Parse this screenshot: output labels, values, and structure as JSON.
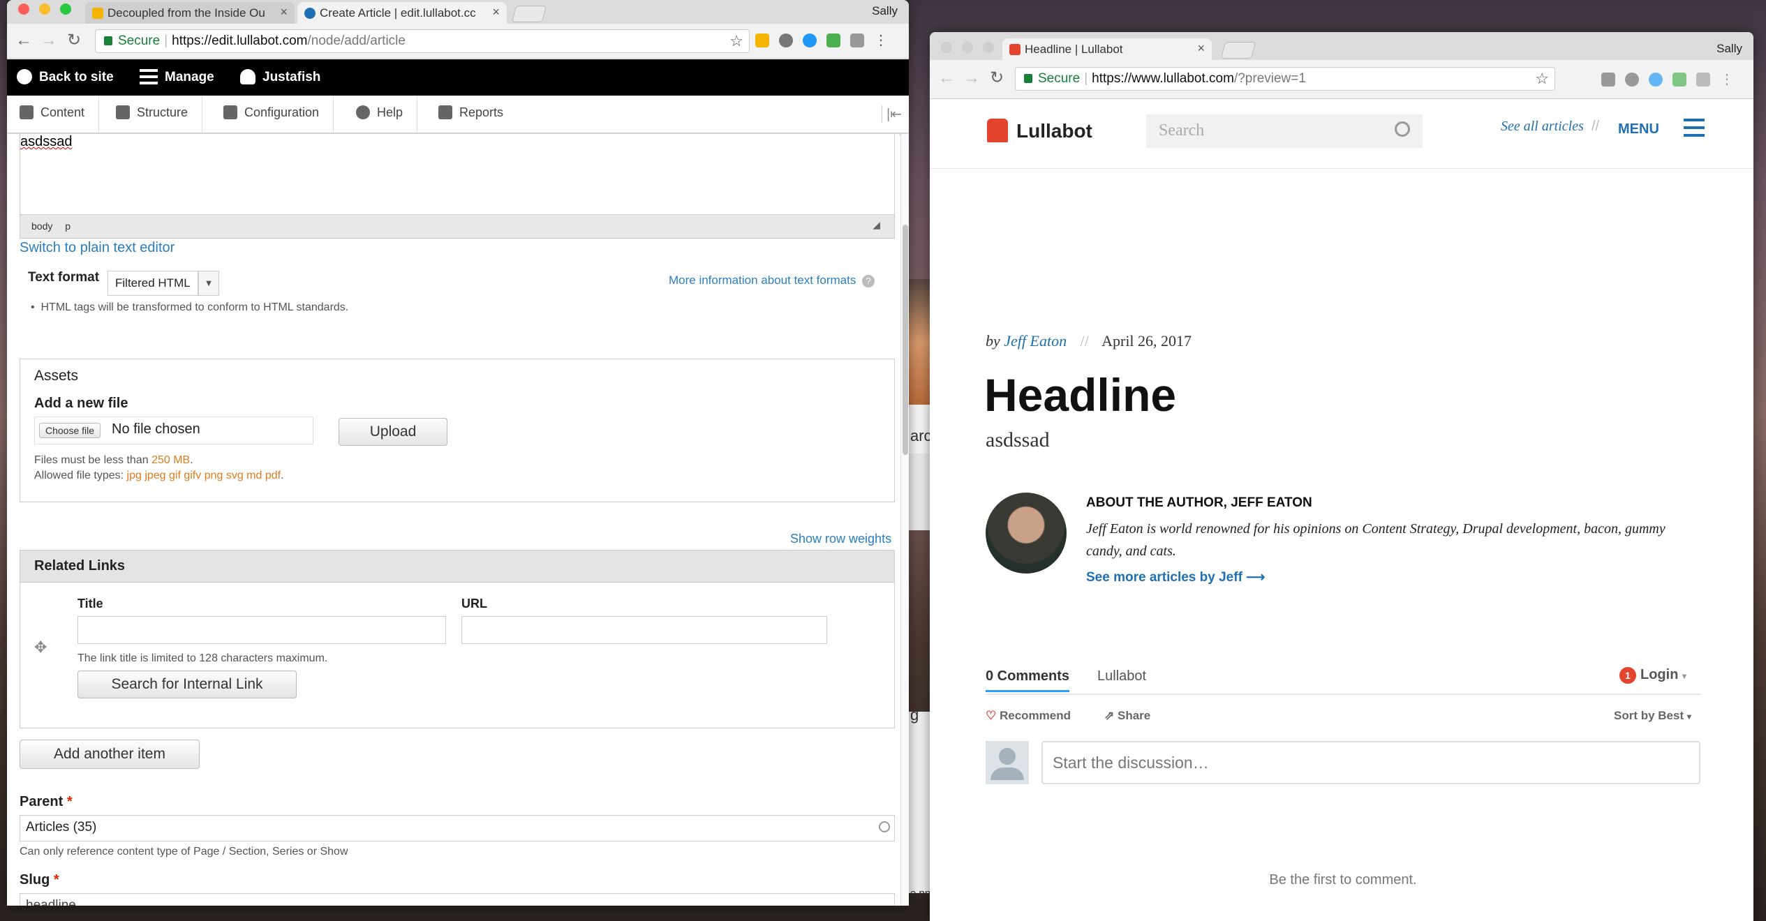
{
  "desktop": {
    "bg_text_1": "g",
    "bg_text_2": "e.pn",
    "bg_text_3": "arch"
  },
  "left_window": {
    "tabs": [
      {
        "label": "Decoupled from the Inside Ou",
        "close": "×"
      },
      {
        "label": "Create Article | edit.lullabot.cc",
        "close": "×"
      }
    ],
    "user": "Sally",
    "address": {
      "secure": "Secure",
      "domain": "https://edit.lullabot.com",
      "path": "/node/add/article"
    },
    "toolbar": {
      "back": "Back to site",
      "manage": "Manage",
      "user": "Justafish"
    },
    "admin_menu": [
      {
        "label": "Content",
        "icon": "content-icon"
      },
      {
        "label": "Structure",
        "icon": "structure-icon"
      },
      {
        "label": "Configuration",
        "icon": "wrench-icon"
      },
      {
        "label": "Help",
        "icon": "help-icon"
      },
      {
        "label": "Reports",
        "icon": "bar-chart-icon"
      }
    ],
    "editor": {
      "text": "asdssad",
      "path_tags": [
        "body",
        "p"
      ],
      "switch_link": "Switch to plain text editor",
      "format_label": "Text format",
      "format_value": "Filtered HTML",
      "more_info": "More information about text formats",
      "tip": "HTML tags will be transformed to conform to HTML standards."
    },
    "assets": {
      "legend": "Assets",
      "add_file": "Add a new file",
      "choose": "Choose file",
      "no_file": "No file chosen",
      "upload": "Upload",
      "limit_prefix": "Files must be less than ",
      "limit_value": "250 MB",
      "limit_suffix": ".",
      "types_prefix": "Allowed file types: ",
      "types_value": "jpg jpeg gif gifv png svg md pdf",
      "types_suffix": "."
    },
    "related": {
      "show_weights": "Show row weights",
      "legend": "Related Links",
      "title_label": "Title",
      "url_label": "URL",
      "title_desc": "The link title is limited to 128 characters maximum.",
      "search_btn": "Search for Internal Link",
      "add_another": "Add another item"
    },
    "parent": {
      "label": "Parent",
      "required": "*",
      "value": "Articles (35)",
      "desc": "Can only reference content type of Page / Section, Series or Show"
    },
    "slug": {
      "label": "Slug",
      "required": "*",
      "value": "headline"
    }
  },
  "right_window": {
    "tab": {
      "label": "Headline | Lullabot",
      "close": "×"
    },
    "user": "Sally",
    "address": {
      "secure": "Secure",
      "domain": "https://www.lullabot.com",
      "path": "/?preview=1"
    },
    "header": {
      "logo": "Lullabot",
      "search_placeholder": "Search",
      "see_all": "See all articles",
      "divider": "//",
      "menu": "MENU"
    },
    "article": {
      "by": "by",
      "author": "Jeff Eaton",
      "divider": "//",
      "date": "April 26, 2017",
      "title": "Headline",
      "body": "asdssad"
    },
    "author_box": {
      "heading": "ABOUT THE AUTHOR, JEFF EATON",
      "bio": "Jeff Eaton is world renowned for his opinions on Content Strategy, Drupal development, bacon, gummy candy, and cats.",
      "more": "See more articles by Jeff",
      "arrow": "⟶"
    },
    "comments": {
      "count_tab": "0 Comments",
      "site_tab": "Lullabot",
      "badge": "1",
      "login": "Login",
      "recommend": "Recommend",
      "share": "Share",
      "sort": "Sort by Best",
      "placeholder": "Start the discussion…",
      "empty": "Be the first to comment."
    }
  }
}
